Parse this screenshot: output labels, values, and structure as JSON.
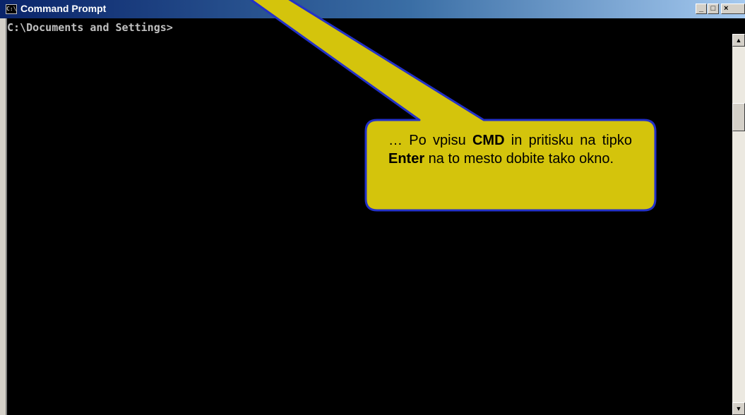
{
  "window": {
    "title": "Command Prompt",
    "icon_text": "C:\\",
    "controls": {
      "minimize": "_",
      "maximize": "□",
      "close": "×"
    }
  },
  "console": {
    "prompt_line": "C:\\Documents and Settings>"
  },
  "callout": {
    "part1": "… Po vpisu ",
    "bold1": "CMD",
    "part2": " in pritisku na tipko ",
    "bold2": "Enter",
    "part3": " na to mesto dobite tako okno."
  },
  "colors": {
    "callout_fill": "#d4c40c",
    "callout_border": "#2331c8",
    "console_bg": "#000000",
    "console_text": "#c0c0c0"
  },
  "icons": {
    "window_icon": "cmd-icon",
    "scroll_up": "arrow-up-icon",
    "scroll_down": "arrow-down-icon"
  }
}
